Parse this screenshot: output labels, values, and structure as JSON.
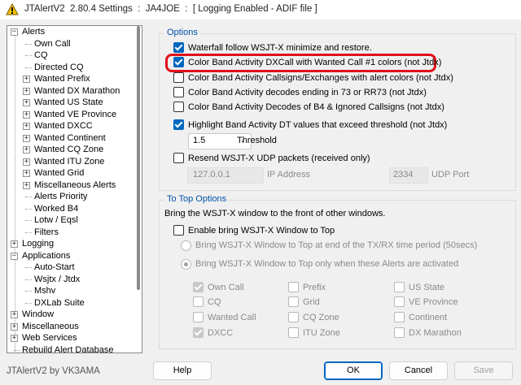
{
  "window": {
    "title": "JTAlertV2  2.80.4 Settings  :  JA4JOE  :  [ Logging Enabled - ADIF file ]",
    "footer": "JTAlertV2 by VK3AMA"
  },
  "tree": {
    "items": [
      {
        "label": "Alerts",
        "expander": "−"
      },
      {
        "label": "Own Call"
      },
      {
        "label": "CQ"
      },
      {
        "label": "Directed CQ"
      },
      {
        "label": "Wanted Prefix",
        "expander": "+"
      },
      {
        "label": "Wanted DX Marathon",
        "expander": "+"
      },
      {
        "label": "Wanted US State",
        "expander": "+"
      },
      {
        "label": "Wanted VE Province",
        "expander": "+"
      },
      {
        "label": "Wanted DXCC",
        "expander": "+"
      },
      {
        "label": "Wanted Continent",
        "expander": "+"
      },
      {
        "label": "Wanted CQ Zone",
        "expander": "+"
      },
      {
        "label": "Wanted ITU Zone",
        "expander": "+"
      },
      {
        "label": "Wanted Grid",
        "expander": "+"
      },
      {
        "label": "Miscellaneous Alerts",
        "expander": "+"
      },
      {
        "label": "Alerts Priority"
      },
      {
        "label": "Worked B4"
      },
      {
        "label": "Lotw / Eqsl"
      },
      {
        "label": "Filters"
      },
      {
        "label": "Logging",
        "expander": "+"
      },
      {
        "label": "Applications",
        "expander": "−"
      },
      {
        "label": "Auto-Start"
      },
      {
        "label": "Wsjtx / Jtdx"
      },
      {
        "label": "Mshv"
      },
      {
        "label": "DXLab Suite"
      },
      {
        "label": "Window",
        "expander": "+"
      },
      {
        "label": "Miscellaneous",
        "expander": "+"
      },
      {
        "label": "Web Services",
        "expander": "+"
      },
      {
        "label": "Rebuild Alert Database"
      }
    ]
  },
  "options": {
    "legend": "Options",
    "waterfall": "Waterfall follow WSJT-X minimize and restore.",
    "color_dxcall": "Color Band Activity DXCall with Wanted Call #1 colors (not Jtdx)",
    "color_callsigns": "Color Band Activity Callsigns/Exchanges with alert colors (not Jtdx)",
    "color_decodes_73": "Color Band Activity decodes ending in 73 or RR73 (not Jtdx)",
    "color_b4": "Color Band Activity Decodes of B4 & Ignored Callsigns (not Jtdx)",
    "highlight_dt": "Highlight Band Activity DT values that exceed threshold (not Jtdx)",
    "threshold_value": "1.5",
    "threshold_label": "Threshold",
    "resend_udp": "Resend WSJT-X UDP packets (received only)",
    "ip_value": "127.0.0.1",
    "ip_label": "IP Address",
    "port_value": "2334",
    "port_label": "UDP Port"
  },
  "to_top": {
    "legend": "To Top Options",
    "desc": "Bring the WSJT-X window to the front of other windows.",
    "enable": "Enable bring WSJT-X Window to Top",
    "radio_end": "Bring WSJT-X Window to Top at end of the TX/RX time period (50secs)",
    "radio_alerts": "Bring WSJT-X Window to Top only when these Alerts are activated",
    "alerts": {
      "own_call": "Own Call",
      "cq": "CQ",
      "wanted_call": "Wanted Call",
      "dxcc": "DXCC",
      "prefix": "Prefix",
      "grid": "Grid",
      "cq_zone": "CQ Zone",
      "itu_zone": "ITU Zone",
      "us_state": "US State",
      "ve_province": "VE Province",
      "continent": "Continent",
      "dx_marathon": "DX Marathon"
    }
  },
  "buttons": {
    "help": "Help",
    "ok": "OK",
    "cancel": "Cancel",
    "save": "Save"
  },
  "colors": {
    "accent": "#0067c0",
    "legend": "#0050a8",
    "highlight": "#e0101a"
  }
}
